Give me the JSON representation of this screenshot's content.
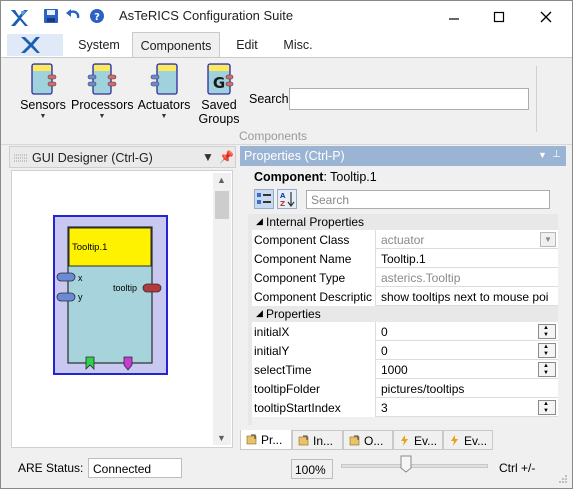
{
  "window": {
    "title": "AsTeRICS Configuration Suite",
    "quick_access": [
      "save-icon",
      "undo-icon",
      "help-icon"
    ],
    "controls": [
      "minimize-icon",
      "maximize-icon",
      "close-icon"
    ]
  },
  "ribbon": {
    "tabs": [
      {
        "label": "System",
        "active": false
      },
      {
        "label": "Components",
        "active": true
      },
      {
        "label": "Edit",
        "active": false
      },
      {
        "label": "Misc.",
        "active": false
      }
    ],
    "buttons": [
      {
        "label": "Sensors",
        "icon": "sensor-component-icon",
        "has_dropdown": true
      },
      {
        "label": "Processors",
        "icon": "processor-component-icon",
        "has_dropdown": true
      },
      {
        "label": "Actuators",
        "icon": "actuator-component-icon",
        "has_dropdown": true
      },
      {
        "label": "Saved Groups",
        "label_line1": "Saved",
        "label_line2": "Groups",
        "icon": "saved-groups-icon",
        "has_dropdown": false
      }
    ],
    "search_label": "Search",
    "search_value": "",
    "group_label": "Components"
  },
  "gui_designer": {
    "title": "GUI Designer (Ctrl-G)",
    "component": {
      "name": "Tooltip.1",
      "inputs": [
        "x",
        "y"
      ],
      "outputs": [
        "tooltip"
      ],
      "colors": {
        "body": "#a6d3dc",
        "header": "#fff200",
        "frame": "#c8c8f0",
        "border": "#2424d6"
      }
    }
  },
  "properties": {
    "title": "Properties (Ctrl-P)",
    "component_label": "Component",
    "component_name": ": Tooltip.1",
    "search_placeholder": "Search",
    "categories": [
      {
        "name": "Internal Properties",
        "rows": [
          {
            "key": "Component Class",
            "value": "actuator",
            "readonly": true,
            "editor": "dropdown"
          },
          {
            "key": "Component Name",
            "value": "Tooltip.1",
            "readonly": false,
            "editor": "text"
          },
          {
            "key": "Component Type",
            "value": "asterics.Tooltip",
            "readonly": true,
            "editor": "text"
          },
          {
            "key": "Component Descriptic",
            "value": "show tooltips next to mouse poi",
            "readonly": false,
            "editor": "text"
          }
        ]
      },
      {
        "name": "Properties",
        "rows": [
          {
            "key": "initialX",
            "value": "0",
            "readonly": false,
            "editor": "spinner"
          },
          {
            "key": "initialY",
            "value": "0",
            "readonly": false,
            "editor": "spinner"
          },
          {
            "key": "selectTime",
            "value": "1000",
            "readonly": false,
            "editor": "spinner"
          },
          {
            "key": "tooltipFolder",
            "value": "pictures/tooltips",
            "readonly": false,
            "editor": "text"
          },
          {
            "key": "tooltipStartIndex",
            "value": "3",
            "readonly": false,
            "editor": "spinner"
          }
        ]
      }
    ],
    "bottom_tabs": [
      {
        "label": "Pr...",
        "icon": "properties-icon",
        "active": true
      },
      {
        "label": "In...",
        "icon": "input-ports-icon",
        "active": false
      },
      {
        "label": "O...",
        "icon": "output-ports-icon",
        "active": false
      },
      {
        "label": "Ev...",
        "icon": "event-listeners-icon",
        "active": false
      },
      {
        "label": "Ev...",
        "icon": "event-triggers-icon",
        "active": false
      }
    ]
  },
  "statusbar": {
    "are_status_label": "ARE Status:",
    "are_status_value": "Connected",
    "zoom": "100%",
    "zoom_shortcut": "Ctrl +/-"
  },
  "colors": {
    "accent": "#9bb4d3",
    "tab_active": "#f0f0f0"
  }
}
